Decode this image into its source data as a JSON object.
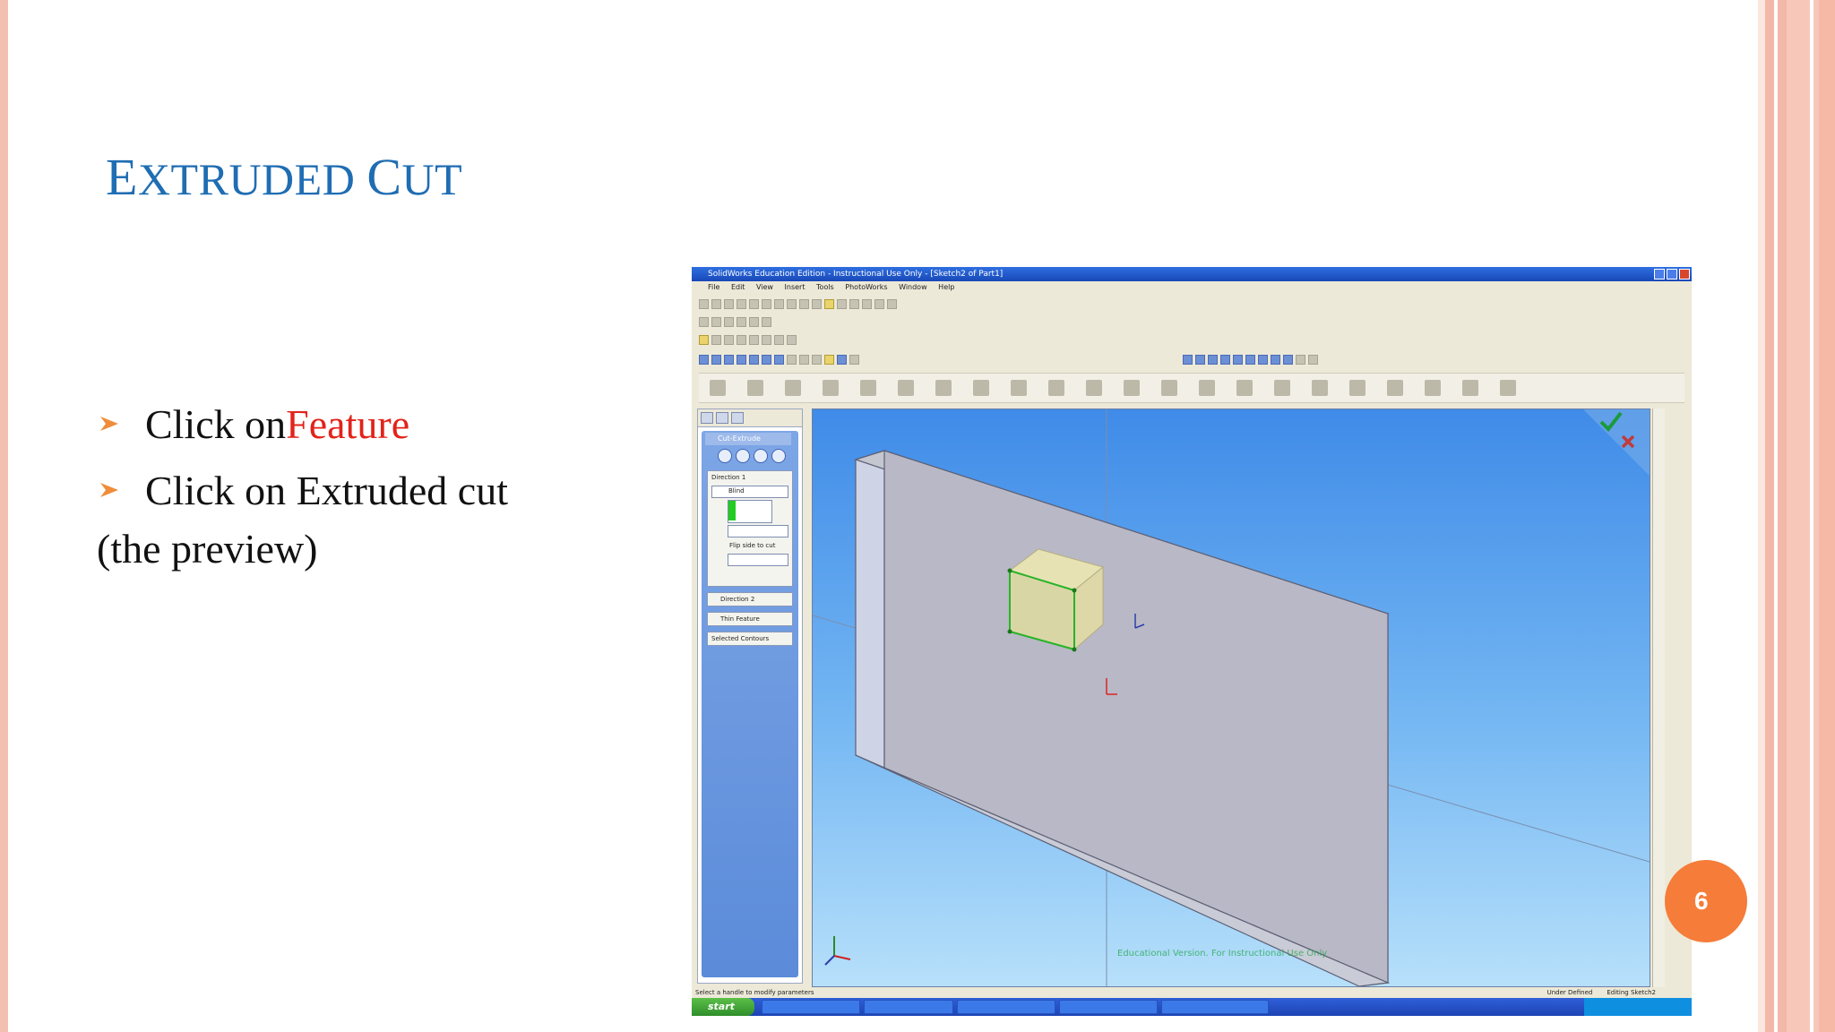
{
  "slide": {
    "title_first_cap": "E",
    "title_rest_1": "XTRUDED ",
    "title_second_cap": "C",
    "title_rest_2": "UT",
    "bullets": [
      {
        "prefix": "Click on ",
        "highlight": "Feature"
      },
      {
        "prefix": "Click on Extruded cut",
        "highlight": ""
      }
    ],
    "note": "(the preview)",
    "page_number": "6"
  },
  "colors": {
    "title": "#1f6db3",
    "highlight": "#e2231a",
    "bullet_arrow": "#f08c3a",
    "page_badge": "#f57c39",
    "border_accent": "#f3b8a8"
  },
  "screenshot": {
    "window_title": "SolidWorks Education Edition - Instructional Use Only - [Sketch2 of Part1]",
    "menu": [
      "File",
      "Edit",
      "View",
      "Insert",
      "Tools",
      "PhotoWorks",
      "Window",
      "Help"
    ],
    "property_manager": {
      "title": "Cut-Extrude",
      "direction1_label": "Direction 1",
      "end_condition": "Blind",
      "flip_side_label": "Flip side to cut",
      "direction2_label": "Direction 2",
      "thin_feature_label": "Thin Feature",
      "selected_contours_label": "Selected Contours"
    },
    "viewport_watermark": "Educational Version. For Instructional Use Only",
    "status_text": "Select a handle to modify parameters",
    "status_right": [
      "Under Defined",
      "Editing Sketch2"
    ],
    "taskbar_start": "start",
    "icons": [
      "confirm-check-icon",
      "cancel-x-icon",
      "triad-icon",
      "origin-icon"
    ]
  }
}
